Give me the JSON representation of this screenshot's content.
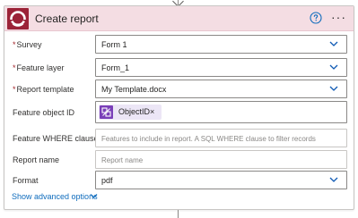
{
  "card": {
    "title": "Create report",
    "help_icon": "help-circle-icon",
    "more_icon": "more-options-icon",
    "more_label": "···",
    "accent": "#9b2338",
    "header_bg": "#f4dde3"
  },
  "fields": {
    "survey": {
      "label": "Survey",
      "required": "*",
      "value": "Form 1"
    },
    "feature_layer": {
      "label": "Feature layer",
      "required": "*",
      "value": "Form_1"
    },
    "report_template": {
      "label": "Report template",
      "required": "*",
      "value": "My Template.docx"
    },
    "feature_object_id": {
      "label": "Feature object ID",
      "token_label": "ObjectID",
      "token_remove": "×",
      "token_color": "#7a3fb8"
    },
    "feature_where": {
      "label": "Feature WHERE clause",
      "placeholder": "Features to include in report. A SQL WHERE clause to filter records"
    },
    "report_name": {
      "label": "Report name",
      "placeholder": "Report name"
    },
    "format": {
      "label": "Format",
      "value": "pdf"
    }
  },
  "footer": {
    "advanced_label": "Show advanced options"
  },
  "colors": {
    "link": "#0f6cbd",
    "chevron": "#0f5ab4",
    "required": "#a4262c"
  }
}
